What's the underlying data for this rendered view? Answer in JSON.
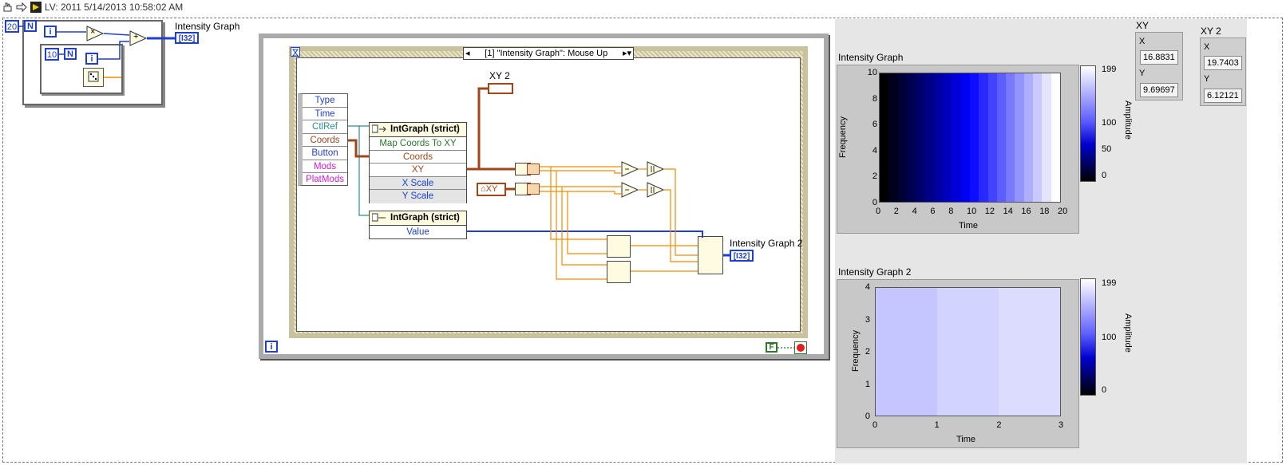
{
  "window": {
    "title": "LV: 2011 5/14/2013 10:58:02 AM"
  },
  "toolbar": {
    "icons": [
      "hand-tool-icon",
      "arrow-right-icon",
      "run-icon"
    ]
  },
  "colors": {
    "int_wire": "#1f3fd0",
    "ref_wire": "#2a8f8f",
    "dbl_wire": "#f28b00",
    "cluster_wire": "#a0461a",
    "panel": "#e6e6e6"
  },
  "left_diagram": {
    "n_const": "20",
    "n_label": "N",
    "i_label": "i",
    "inner_n_const": "10",
    "inner_n_label": "N",
    "inner_i_label": "i",
    "multiply": "×",
    "add": "+",
    "dice_icon": "random-number-icon",
    "terminal_label": "Intensity Graph",
    "terminal_type": "[I32]"
  },
  "event_struct": {
    "selector": "[1] \"Intensity Graph\": Mouse Up",
    "event_data": [
      "Type",
      "Time",
      "CtlRef",
      "Coords",
      "Button",
      "Mods",
      "PlatMods"
    ],
    "xy2_label": "XY 2",
    "xy2_type": "XY",
    "invoke_node": {
      "title": "IntGraph (strict)",
      "method": "Map Coords To XY",
      "rows": [
        "Coords",
        "XY",
        "X Scale",
        "Y Scale"
      ]
    },
    "prop_node": {
      "title": "IntGraph (strict)",
      "rows": [
        "Value"
      ]
    },
    "local_xy": "XY",
    "graph2_label": "Intensity Graph 2",
    "graph2_type": "[I32]",
    "loop_i": "i",
    "stop_const": "F"
  },
  "panel": {
    "graph1": {
      "label": "Intensity Graph",
      "x_title": "Time",
      "y_title": "Frequency",
      "z_title": "Amplitude",
      "x_ticks": [
        "0",
        "2",
        "4",
        "6",
        "8",
        "10",
        "12",
        "14",
        "16",
        "18",
        "20"
      ],
      "y_ticks": [
        "10",
        "8",
        "6",
        "4",
        "2",
        "0"
      ],
      "z_ticks": [
        "199",
        "100",
        "50",
        "0"
      ],
      "columns": 20,
      "z_min": 0,
      "z_max": 199
    },
    "graph2": {
      "label": "Intensity Graph 2",
      "x_title": "Time",
      "y_title": "Frequency",
      "z_title": "Amplitude",
      "x_ticks": [
        "0",
        "1",
        "2",
        "3"
      ],
      "y_ticks": [
        "4",
        "3",
        "2",
        "1",
        "0"
      ],
      "z_ticks": [
        "199",
        "100",
        "0"
      ],
      "column_levels": [
        0.12,
        0.06,
        0.02
      ]
    },
    "xy": {
      "label": "XY",
      "x_label": "X",
      "x_value": "16.8831",
      "y_label": "Y",
      "y_value": "9.69697"
    },
    "xy2": {
      "label": "XY 2",
      "x_label": "X",
      "x_value": "19.7403",
      "y_label": "Y",
      "y_value": "6.12121"
    }
  }
}
